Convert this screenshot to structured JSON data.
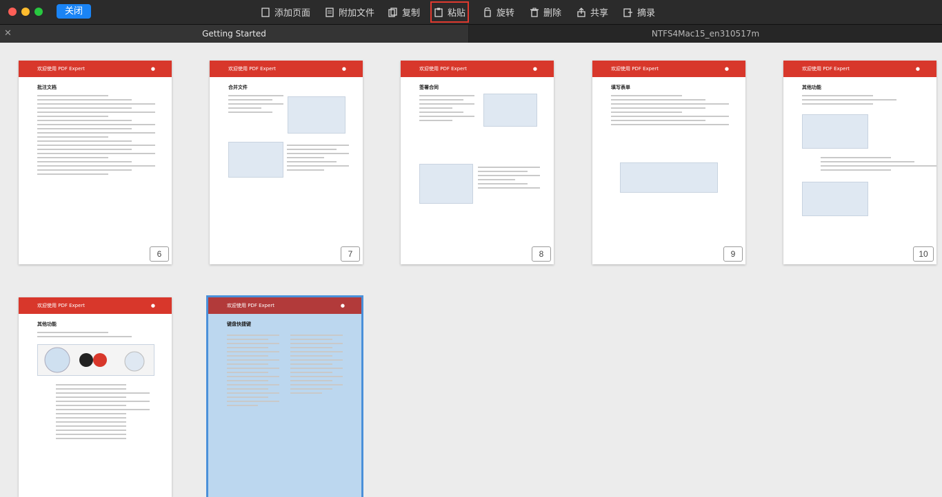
{
  "window": {
    "close_label": "关闭"
  },
  "toolbar": {
    "items": [
      {
        "label": "添加页面",
        "icon": "add-page-icon"
      },
      {
        "label": "附加文件",
        "icon": "attach-file-icon"
      },
      {
        "label": "复制",
        "icon": "copy-icon"
      },
      {
        "label": "粘贴",
        "icon": "paste-icon",
        "highlighted": true
      },
      {
        "label": "旋转",
        "icon": "rotate-icon"
      },
      {
        "label": "删除",
        "icon": "trash-icon"
      },
      {
        "label": "共享",
        "icon": "share-icon"
      },
      {
        "label": "摘录",
        "icon": "extract-icon"
      }
    ],
    "highlight_color": "#e03a2f"
  },
  "tabs": [
    {
      "label": "Getting Started",
      "active": true
    },
    {
      "label": "NTFS4Mac15_en310517m",
      "active": false
    }
  ],
  "pages": [
    {
      "number": "6",
      "header": "欢迎使用 PDF Expert",
      "title": "批注文档"
    },
    {
      "number": "7",
      "header": "欢迎使用 PDF Expert",
      "title": "合并文件"
    },
    {
      "number": "8",
      "header": "欢迎使用 PDF Expert",
      "title": "签署合同"
    },
    {
      "number": "9",
      "header": "欢迎使用 PDF Expert",
      "title": "填写表单"
    },
    {
      "number": "10",
      "header": "欢迎使用 PDF Expert",
      "title": "其他功能"
    },
    {
      "number": "",
      "header": "欢迎使用 PDF Expert",
      "title": "其他功能"
    },
    {
      "number": "",
      "header": "欢迎使用 PDF Expert",
      "title": "键盘快捷键",
      "selected": true
    }
  ],
  "colors": {
    "page_header_red": "#d8372b",
    "selected_page_bg": "#bcd7ef",
    "selected_outline": "#4a90d9",
    "close_button_blue": "#1a84f5"
  }
}
